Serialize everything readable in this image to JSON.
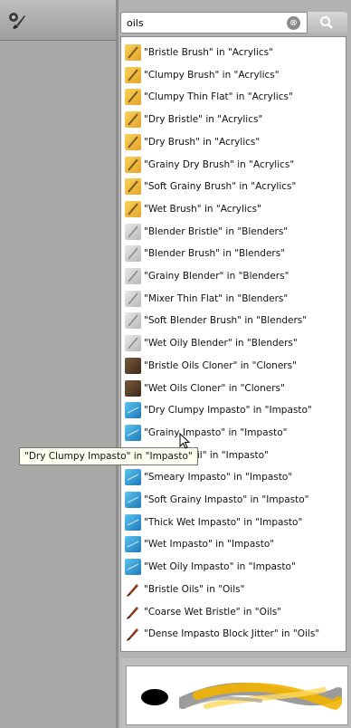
{
  "search": {
    "value": "oils",
    "clear_label": "⊗",
    "search_icon": "magnifier-icon"
  },
  "toolbar": {
    "tool_icon": "brush-variant-icon"
  },
  "results": [
    {
      "label": "\"Bristle Brush\" in \"Acrylics\"",
      "category": "Acrylics",
      "icon": "acrylic-brush-icon"
    },
    {
      "label": "\"Clumpy Brush\" in \"Acrylics\"",
      "category": "Acrylics",
      "icon": "acrylic-brush-icon"
    },
    {
      "label": "\"Clumpy Thin Flat\" in \"Acrylics\"",
      "category": "Acrylics",
      "icon": "acrylic-brush-icon"
    },
    {
      "label": "\"Dry Bristle\" in \"Acrylics\"",
      "category": "Acrylics",
      "icon": "acrylic-brush-icon"
    },
    {
      "label": "\"Dry Brush\" in \"Acrylics\"",
      "category": "Acrylics",
      "icon": "acrylic-brush-icon"
    },
    {
      "label": "\"Grainy Dry Brush\" in \"Acrylics\"",
      "category": "Acrylics",
      "icon": "acrylic-brush-icon"
    },
    {
      "label": "\"Soft Grainy Brush\" in \"Acrylics\"",
      "category": "Acrylics",
      "icon": "acrylic-brush-icon"
    },
    {
      "label": "\"Wet Brush\" in \"Acrylics\"",
      "category": "Acrylics",
      "icon": "acrylic-brush-icon"
    },
    {
      "label": "\"Blender Bristle\" in \"Blenders\"",
      "category": "Blenders",
      "icon": "blender-icon"
    },
    {
      "label": "\"Blender Brush\" in \"Blenders\"",
      "category": "Blenders",
      "icon": "blender-icon"
    },
    {
      "label": "\"Grainy Blender\" in \"Blenders\"",
      "category": "Blenders",
      "icon": "blender-icon"
    },
    {
      "label": "\"Mixer Thin Flat\" in \"Blenders\"",
      "category": "Blenders",
      "icon": "blender-icon"
    },
    {
      "label": "\"Soft Blender Brush\" in \"Blenders\"",
      "category": "Blenders",
      "icon": "blender-icon"
    },
    {
      "label": "\"Wet Oily Blender\" in \"Blenders\"",
      "category": "Blenders",
      "icon": "blender-icon"
    },
    {
      "label": "\"Bristle Oils Cloner\" in \"Cloners\"",
      "category": "Cloners",
      "icon": "cloner-icon"
    },
    {
      "label": "\"Wet Oils Cloner\" in \"Cloners\"",
      "category": "Cloners",
      "icon": "cloner-icon"
    },
    {
      "label": "\"Dry Clumpy Impasto\" in \"Impasto\"",
      "category": "Impasto",
      "icon": "impasto-icon"
    },
    {
      "label": "\"Grainy Impasto\" in \"Impasto\"",
      "category": "Impasto",
      "icon": "impasto-icon"
    },
    {
      "label": "\"Impasto Oil\" in \"Impasto\"",
      "category": "Impasto",
      "icon": "impasto-icon"
    },
    {
      "label": "\"Smeary Impasto\" in \"Impasto\"",
      "category": "Impasto",
      "icon": "impasto-icon"
    },
    {
      "label": "\"Soft Grainy Impasto\" in \"Impasto\"",
      "category": "Impasto",
      "icon": "impasto-icon"
    },
    {
      "label": "\"Thick Wet Impasto\" in \"Impasto\"",
      "category": "Impasto",
      "icon": "impasto-icon"
    },
    {
      "label": "\"Wet Impasto\" in \"Impasto\"",
      "category": "Impasto",
      "icon": "impasto-icon"
    },
    {
      "label": "\"Wet Oily Impasto\" in \"Impasto\"",
      "category": "Impasto",
      "icon": "impasto-icon"
    },
    {
      "label": "\"Bristle Oils\" in \"Oils\"",
      "category": "Oils",
      "icon": "oils-brush-icon"
    },
    {
      "label": "\"Coarse Wet Bristle\" in \"Oils\"",
      "category": "Oils",
      "icon": "oils-brush-icon"
    },
    {
      "label": "\"Dense Impasto Block Jitter\" in \"Oils\"",
      "category": "Oils",
      "icon": "oils-brush-icon"
    }
  ],
  "tooltip": {
    "text": "\"Dry Clumpy Impasto\" in \"Impasto\""
  },
  "preview": {
    "dab_icon": "dab-preview-icon",
    "stroke_icon": "stroke-preview-icon"
  }
}
